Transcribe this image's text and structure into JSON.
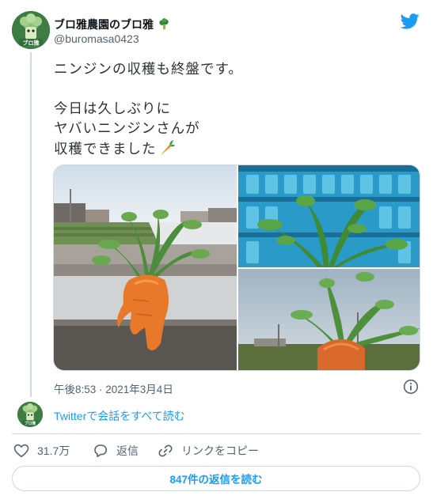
{
  "author": {
    "display_name": "ブロ雅農園のブロ雅",
    "handle": "@buromasa0423",
    "avatar_text": "ブロ雅"
  },
  "tweet": {
    "lines": [
      "ニンジンの収穫も終盤です。",
      "",
      "今日は久しぶりに",
      "ヤバいニンジンさんが",
      "収穫できました"
    ],
    "emoji": "carrot-emoji"
  },
  "media": {
    "photos": [
      {
        "name": "mandrake-carrot-field-photo"
      },
      {
        "name": "carrot-leaves-crate-photo"
      },
      {
        "name": "carrot-sky-photo"
      }
    ]
  },
  "meta": {
    "timestamp": "午後8:53 · 2021年3月4日"
  },
  "conversation": {
    "link": "Twitterで会話をすべて読む"
  },
  "actions": {
    "likes": "31.7万",
    "reply": "返信",
    "copy_link": "リンクをコピー"
  },
  "read_replies": "847件の返信を読む",
  "colors": {
    "accent": "#1d9bf0",
    "text": "#0f1419",
    "muted": "#536471",
    "border": "#cfd9de"
  }
}
